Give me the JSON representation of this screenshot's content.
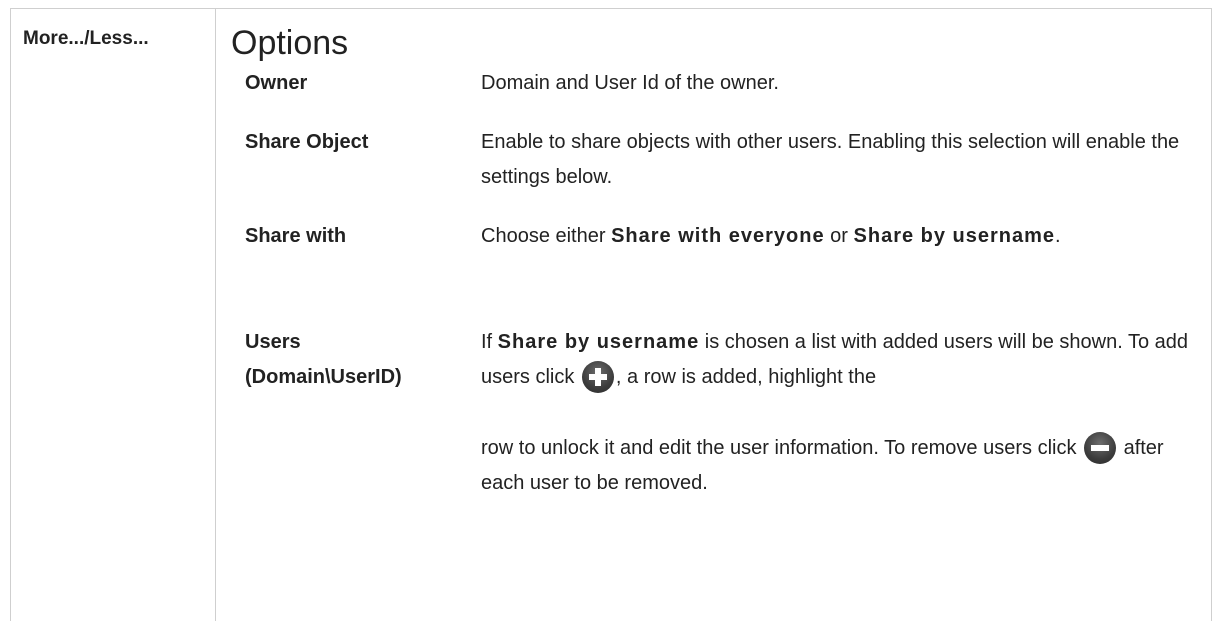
{
  "sidebar": {
    "toggle_label": "More.../Less..."
  },
  "main": {
    "heading": "Options",
    "rows": [
      {
        "term": "Owner",
        "desc": "Domain and User Id of the owner."
      },
      {
        "term": "Share Object",
        "desc": "Enable to share objects with other users. Enabling this selection will enable the settings below."
      },
      {
        "term": "Share with",
        "desc_a": "Choose either ",
        "emph_a": "Share with everyone",
        "desc_b": " or ",
        "emph_b": "Share by username",
        "desc_c": "."
      },
      {
        "term_line1": "Users",
        "term_line2": "(Domain\\UserID)",
        "p1_a": "If ",
        "p1_emph": "Share by username",
        "p1_b": " is chosen a list with added users will be shown. To add users click ",
        "p1_c": ", a row is added, highlight the",
        "p2_a": "row to unlock it and edit the user information. To remove users click ",
        "p2_b": " after each user to be removed."
      }
    ],
    "icons": {
      "add": "add-user-icon",
      "remove": "remove-user-icon"
    }
  }
}
